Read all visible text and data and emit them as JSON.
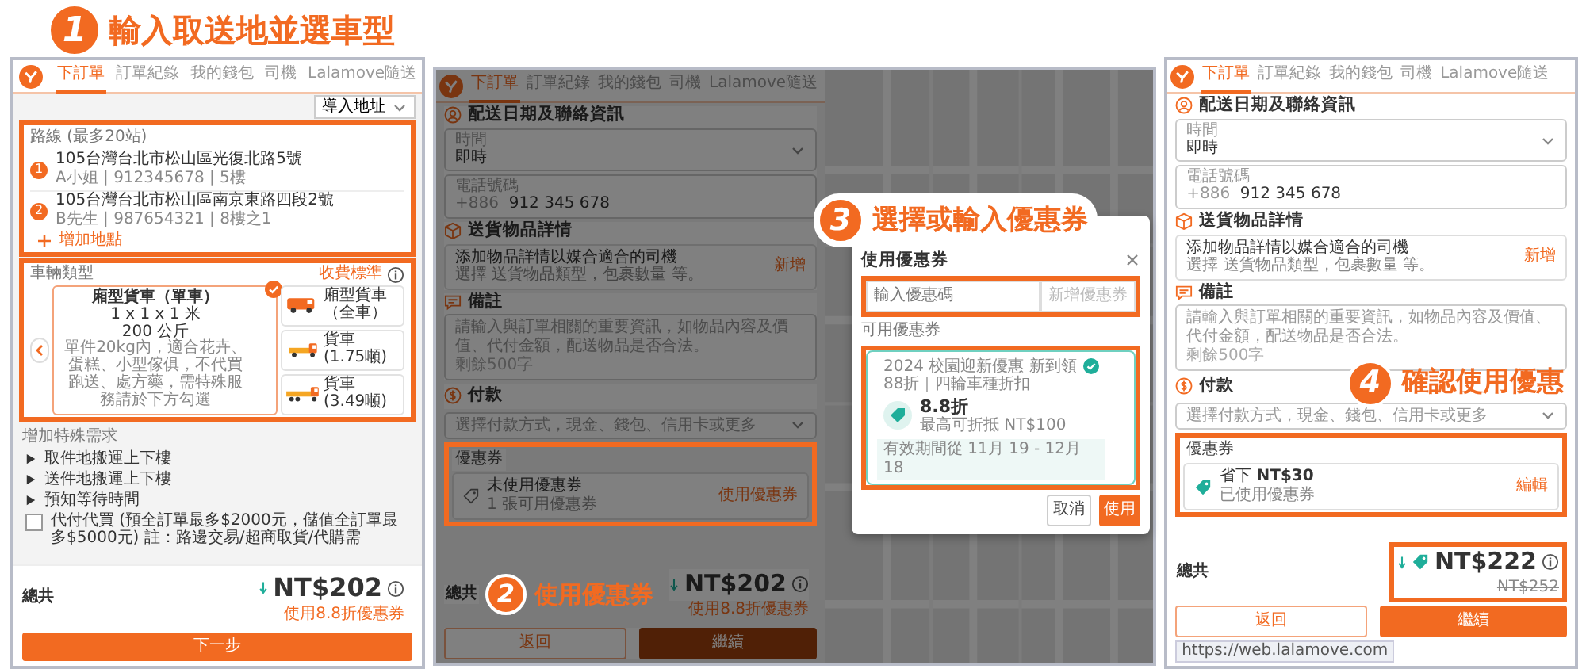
{
  "steps": [
    {
      "number": "1",
      "text": "輸入取送地並選車型"
    },
    {
      "number": "2",
      "text": "使用優惠券"
    },
    {
      "number": "3",
      "text": "選擇或輸入優惠券"
    },
    {
      "number": "4",
      "text": "確認使用優惠"
    }
  ],
  "order_panel": {
    "tabs": [
      {
        "label": "下訂單",
        "selected": true
      },
      {
        "label": "訂單紀錄",
        "selected": false
      },
      {
        "label": "我的錢包",
        "selected": false
      },
      {
        "label": "司機",
        "selected": false
      },
      {
        "label": "Lalamove隨送",
        "selected": false
      }
    ],
    "import_button": "導入地址",
    "route": {
      "label": "路線 (最多20站)",
      "highlighted": true,
      "stops": [
        {
          "number": "1",
          "address": "105台灣台北市松山區光復北路5號",
          "contact": "A小姐 | 912345678 | 5樓"
        },
        {
          "number": "2",
          "address": "105台灣台北市松山區南京東路四段2號",
          "contact": "B先生 | 987654321 | 8樓之1"
        }
      ],
      "add_stop": "增加地點"
    },
    "vehicles": {
      "label": "車輛類型",
      "rates": "收費標準",
      "highlighted": true,
      "items": [
        {
          "kind": "detail",
          "name": "廂型貨車（單車）",
          "size": "1 x 1 x 1 米",
          "weight": "200 公斤",
          "description": "單件20kg內，適合花卉、蛋糕、小型傢俱，不代買跑送、處方藥，需特殊服務請於下方勾選",
          "selected": true
        },
        {
          "kind": "van",
          "name": "廂型貨車（全車）",
          "selected": false
        },
        {
          "kind": "truck",
          "name": "貨車 (1.75噸)",
          "selected": false
        },
        {
          "kind": "flatbed",
          "name": "貨車 (3.49噸)",
          "selected": false
        }
      ]
    },
    "extras_label": "增加特殊需求",
    "extras": [
      {
        "label": "取件地搬運上下樓",
        "expanded": false
      },
      {
        "label": "送件地搬運上下樓",
        "expanded": false
      },
      {
        "label": "預知等待時間",
        "expanded": false
      }
    ],
    "cash_option": {
      "label": "代付代買 (預全訂單最多$2000元，儲值全訂單最多$5000元) 註：路邊交易/超商取貨/代購需",
      "checked": false
    },
    "total": {
      "label": "總共",
      "price": "NT$202",
      "note": "使用8.8折優惠券"
    },
    "next_button": "下一步"
  },
  "coupon_panel": {
    "tabs": [
      {
        "label": "下訂單",
        "selected": true
      },
      {
        "label": "訂單紀錄",
        "selected": false
      },
      {
        "label": "我的錢包",
        "selected": false
      },
      {
        "label": "司機",
        "selected": false
      },
      {
        "label": "Lalamove隨送",
        "selected": false
      }
    ],
    "contact": {
      "title": "配送日期及聯絡資訊",
      "time_label": "時間",
      "time_value": "即時",
      "phone_label": "電話號碼",
      "phone_prefix": "+886",
      "phone_value": "912 345 678"
    },
    "items": {
      "title": "送貨物品詳情",
      "text": "添加物品詳情以媒合適合的司機",
      "hint": "選擇 送貨物品類型，包裹數量 等。",
      "action": "新增"
    },
    "notes": {
      "title": "備註",
      "placeholder": "請輸入與訂單相關的重要資訊，如物品內容及價值、代付金額，配送物品是否合法。",
      "counter": "剩餘500字"
    },
    "payment": {
      "title": "付款",
      "placeholder": "選擇付款方式，現金、錢包、信用卡或更多"
    },
    "coupon": {
      "label": "優惠券",
      "title": "未使用優惠券",
      "subtitle": "1 張可用優惠券",
      "action": "使用優惠券",
      "applied": false,
      "highlighted": true
    },
    "total": {
      "label": "總共",
      "price": "NT$202",
      "note": "使用8.8折優惠券",
      "highlighted": false
    },
    "back_button": "返回",
    "continue_button": "繼續",
    "modal": {
      "title": "使用優惠券",
      "code_placeholder": "輸入優惠碼",
      "add_button": "新增優惠券",
      "add_disabled": true,
      "input_highlighted": true,
      "available_label": "可用優惠券",
      "list_highlighted": true,
      "coupons": [
        {
          "campaign": "2024 校園迎新優惠 新到領88折｜四輪車種折扣",
          "discount": "8.8折",
          "cap": "最高可折抵 NT$100",
          "validity": "有效期間從 11月 19 - 12月 18",
          "selected": true
        }
      ],
      "cancel_button": "取消",
      "apply_button": "使用"
    }
  },
  "confirm_panel": {
    "tabs": [
      {
        "label": "下訂單",
        "selected": true
      },
      {
        "label": "訂單紀錄",
        "selected": false
      },
      {
        "label": "我的錢包",
        "selected": false
      },
      {
        "label": "司機",
        "selected": false
      },
      {
        "label": "Lalamove隨送",
        "selected": false
      }
    ],
    "contact": {
      "title": "配送日期及聯絡資訊",
      "time_label": "時間",
      "time_value": "即時",
      "phone_label": "電話號碼",
      "phone_prefix": "+886",
      "phone_value": "912 345 678"
    },
    "items": {
      "title": "送貨物品詳情",
      "text": "添加物品詳情以媒合適合的司機",
      "hint": "選擇 送貨物品類型，包裹數量 等。",
      "action": "新增"
    },
    "notes": {
      "title": "備註",
      "placeholder": "請輸入與訂單相關的重要資訊，如物品內容及價值、代付金額，配送物品是否合法。",
      "counter": "剩餘500字"
    },
    "payment": {
      "title": "付款",
      "placeholder": "選擇付款方式，現金、錢包、信用卡或更多"
    },
    "coupon": {
      "label": "優惠券",
      "title": "省下 **NT$30**",
      "subtitle": "已使用優惠券",
      "action": "編輯",
      "applied": true,
      "highlighted": true
    },
    "total": {
      "label": "總共",
      "price": "NT$222",
      "original_price": "NT$252",
      "highlighted": true
    },
    "back_button": "返回",
    "continue_button": "繼續",
    "status_url": "https://web.lalamove.com"
  }
}
